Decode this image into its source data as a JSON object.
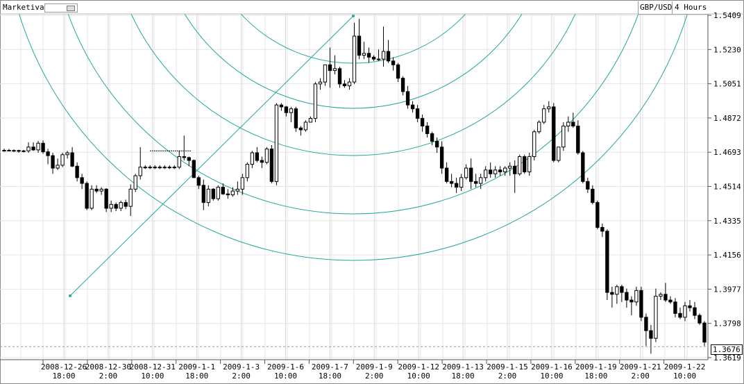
{
  "app": {
    "name": "Marketiva"
  },
  "instrument": {
    "symbol": "GBP/USD",
    "timeframe": "4 Hours"
  },
  "current_price": "1.3676",
  "colors": {
    "arc": "#22a89a",
    "up_fill": "#ffffff",
    "down_fill": "#000000",
    "grid": "#e6e6e6"
  },
  "chart_data": {
    "type": "candlestick",
    "y_ticks": [
      "1.5409",
      "1.5230",
      "1.5051",
      "1.4872",
      "1.4693",
      "1.4514",
      "1.4335",
      "1.4156",
      "1.3977",
      "1.3798",
      "1.3619"
    ],
    "ylim": [
      1.3585,
      1.543
    ],
    "x_ticks": [
      {
        "date": "2008-12-26",
        "time": "18:00"
      },
      {
        "date": "2008-12-30",
        "time": "2:00"
      },
      {
        "date": "2008-12-31",
        "time": "10:00"
      },
      {
        "date": "2009-1-1",
        "time": "18:00"
      },
      {
        "date": "2009-1-3",
        "time": "2:00"
      },
      {
        "date": "2009-1-6",
        "time": "10:00"
      },
      {
        "date": "2009-1-7",
        "time": "18:00"
      },
      {
        "date": "2009-1-9",
        "time": "2:00"
      },
      {
        "date": "2009-1-12",
        "time": "10:00"
      },
      {
        "date": "2009-1-13",
        "time": "18:00"
      },
      {
        "date": "2009-1-15",
        "time": "2:00"
      },
      {
        "date": "2009-1-16",
        "time": "10:00"
      },
      {
        "date": "2009-1-19",
        "time": "18:00"
      },
      {
        "date": "2009-1-21",
        "time": "2:00"
      },
      {
        "date": "2009-1-22",
        "time": "10:00"
      }
    ],
    "candles": [
      [
        1.47,
        1.4712,
        1.4695,
        1.4703
      ],
      [
        1.4703,
        1.471,
        1.4698,
        1.47
      ],
      [
        1.47,
        1.4708,
        1.4695,
        1.4702
      ],
      [
        1.4702,
        1.4706,
        1.469,
        1.4698
      ],
      [
        1.4698,
        1.4705,
        1.4692,
        1.47
      ],
      [
        1.47,
        1.4745,
        1.469,
        1.472
      ],
      [
        1.472,
        1.4745,
        1.47,
        1.4705
      ],
      [
        1.4705,
        1.4752,
        1.469,
        1.474
      ],
      [
        1.474,
        1.4755,
        1.4685,
        1.4695
      ],
      [
        1.4695,
        1.471,
        1.463,
        1.4675
      ],
      [
        1.4675,
        1.469,
        1.458,
        1.461
      ],
      [
        1.461,
        1.466,
        1.46,
        1.4625
      ],
      [
        1.4625,
        1.469,
        1.4615,
        1.468
      ],
      [
        1.468,
        1.47,
        1.466,
        1.469
      ],
      [
        1.469,
        1.472,
        1.4615,
        1.462
      ],
      [
        1.462,
        1.464,
        1.454,
        1.456
      ],
      [
        1.456,
        1.458,
        1.45,
        1.453
      ],
      [
        1.453,
        1.454,
        1.439,
        1.44
      ],
      [
        1.44,
        1.452,
        1.439,
        1.45
      ],
      [
        1.45,
        1.452,
        1.448,
        1.449
      ],
      [
        1.449,
        1.451,
        1.447,
        1.45
      ],
      [
        1.45,
        1.4505,
        1.438,
        1.44
      ],
      [
        1.44,
        1.444,
        1.438,
        1.442
      ],
      [
        1.442,
        1.443,
        1.4385,
        1.44
      ],
      [
        1.44,
        1.444,
        1.4385,
        1.443
      ],
      [
        1.443,
        1.4445,
        1.4395,
        1.441
      ],
      [
        1.441,
        1.4525,
        1.436,
        1.45
      ],
      [
        1.45,
        1.458,
        1.4485,
        1.457
      ],
      [
        1.457,
        1.472,
        1.455,
        1.4615
      ],
      [
        1.4615,
        1.4625,
        1.4605,
        1.4615
      ],
      [
        1.4615,
        1.4625,
        1.4605,
        1.4615
      ],
      [
        1.4615,
        1.4625,
        1.4605,
        1.4615
      ],
      [
        1.4615,
        1.4625,
        1.4605,
        1.4615
      ],
      [
        1.4615,
        1.4625,
        1.4605,
        1.4615
      ],
      [
        1.4615,
        1.4625,
        1.4605,
        1.4615
      ],
      [
        1.4615,
        1.4625,
        1.4605,
        1.4615
      ],
      [
        1.4615,
        1.47,
        1.4605,
        1.467
      ],
      [
        1.467,
        1.478,
        1.465,
        1.4665
      ],
      [
        1.4665,
        1.467,
        1.462,
        1.465
      ],
      [
        1.465,
        1.4655,
        1.456,
        1.456
      ],
      [
        1.456,
        1.457,
        1.45,
        1.452
      ],
      [
        1.452,
        1.455,
        1.439,
        1.443
      ],
      [
        1.443,
        1.452,
        1.441,
        1.45
      ],
      [
        1.45,
        1.4505,
        1.444,
        1.445
      ],
      [
        1.445,
        1.452,
        1.444,
        1.451
      ],
      [
        1.451,
        1.453,
        1.447,
        1.4475
      ],
      [
        1.4475,
        1.45,
        1.445,
        1.447
      ],
      [
        1.447,
        1.451,
        1.446,
        1.449
      ],
      [
        1.449,
        1.454,
        1.447,
        1.45
      ],
      [
        1.45,
        1.458,
        1.447,
        1.456
      ],
      [
        1.456,
        1.464,
        1.454,
        1.463
      ],
      [
        1.463,
        1.47,
        1.461,
        1.469
      ],
      [
        1.469,
        1.472,
        1.464,
        1.465
      ],
      [
        1.465,
        1.467,
        1.461,
        1.464
      ],
      [
        1.464,
        1.472,
        1.463,
        1.471
      ],
      [
        1.471,
        1.473,
        1.453,
        1.454
      ],
      [
        1.454,
        1.495,
        1.452,
        1.494
      ],
      [
        1.494,
        1.495,
        1.491,
        1.493
      ],
      [
        1.493,
        1.4935,
        1.488,
        1.49
      ],
      [
        1.49,
        1.493,
        1.485,
        1.492
      ],
      [
        1.492,
        1.493,
        1.48,
        1.482
      ],
      [
        1.482,
        1.483,
        1.478,
        1.481
      ],
      [
        1.481,
        1.486,
        1.48,
        1.485
      ],
      [
        1.485,
        1.488,
        1.485,
        1.487
      ],
      [
        1.487,
        1.506,
        1.485,
        1.505
      ],
      [
        1.505,
        1.508,
        1.502,
        1.506
      ],
      [
        1.506,
        1.515,
        1.504,
        1.515
      ],
      [
        1.515,
        1.524,
        1.503,
        1.512
      ],
      [
        1.512,
        1.52,
        1.51,
        1.513
      ],
      [
        1.513,
        1.514,
        1.503,
        1.505
      ],
      [
        1.505,
        1.507,
        1.503,
        1.504
      ],
      [
        1.504,
        1.508,
        1.502,
        1.506
      ],
      [
        1.506,
        1.537,
        1.505,
        1.53
      ],
      [
        1.53,
        1.539,
        1.518,
        1.52
      ],
      [
        1.52,
        1.527,
        1.518,
        1.521
      ],
      [
        1.521,
        1.524,
        1.516,
        1.519
      ],
      [
        1.519,
        1.52,
        1.517,
        1.518
      ],
      [
        1.518,
        1.523,
        1.517,
        1.518
      ],
      [
        1.518,
        1.535,
        1.514,
        1.522
      ],
      [
        1.522,
        1.528,
        1.516,
        1.517
      ],
      [
        1.517,
        1.519,
        1.512,
        1.515
      ],
      [
        1.515,
        1.516,
        1.506,
        1.508
      ],
      [
        1.508,
        1.509,
        1.499,
        1.501
      ],
      [
        1.501,
        1.504,
        1.492,
        1.494
      ],
      [
        1.494,
        1.496,
        1.49,
        1.492
      ],
      [
        1.492,
        1.494,
        1.485,
        1.487
      ],
      [
        1.487,
        1.489,
        1.48,
        1.483
      ],
      [
        1.483,
        1.485,
        1.477,
        1.479
      ],
      [
        1.479,
        1.48,
        1.473,
        1.475
      ],
      [
        1.475,
        1.477,
        1.469,
        1.472
      ],
      [
        1.472,
        1.475,
        1.458,
        1.461
      ],
      [
        1.461,
        1.464,
        1.453,
        1.454
      ],
      [
        1.454,
        1.458,
        1.451,
        1.453
      ],
      [
        1.453,
        1.456,
        1.448,
        1.451
      ],
      [
        1.451,
        1.458,
        1.449,
        1.456
      ],
      [
        1.456,
        1.463,
        1.455,
        1.461
      ],
      [
        1.461,
        1.466,
        1.45,
        1.454
      ],
      [
        1.454,
        1.458,
        1.451,
        1.453
      ],
      [
        1.453,
        1.458,
        1.45,
        1.456
      ],
      [
        1.456,
        1.462,
        1.454,
        1.46
      ],
      [
        1.46,
        1.464,
        1.456,
        1.458
      ],
      [
        1.458,
        1.462,
        1.456,
        1.46
      ],
      [
        1.46,
        1.462,
        1.457,
        1.459
      ],
      [
        1.459,
        1.462,
        1.457,
        1.461
      ],
      [
        1.461,
        1.464,
        1.457,
        1.462
      ],
      [
        1.462,
        1.465,
        1.448,
        1.458
      ],
      [
        1.458,
        1.468,
        1.457,
        1.467
      ],
      [
        1.467,
        1.468,
        1.458,
        1.459
      ],
      [
        1.459,
        1.469,
        1.457,
        1.467
      ],
      [
        1.467,
        1.481,
        1.465,
        1.48
      ],
      [
        1.48,
        1.486,
        1.479,
        1.485
      ],
      [
        1.485,
        1.494,
        1.484,
        1.492
      ],
      [
        1.492,
        1.496,
        1.49,
        1.493
      ],
      [
        1.493,
        1.495,
        1.464,
        1.465
      ],
      [
        1.465,
        1.472,
        1.464,
        1.472
      ],
      [
        1.472,
        1.485,
        1.47,
        1.483
      ],
      [
        1.483,
        1.488,
        1.48,
        1.485
      ],
      [
        1.485,
        1.49,
        1.482,
        1.483
      ],
      [
        1.483,
        1.486,
        1.468,
        1.469
      ],
      [
        1.469,
        1.47,
        1.453,
        1.454
      ],
      [
        1.454,
        1.456,
        1.448,
        1.45
      ],
      [
        1.45,
        1.452,
        1.442,
        1.443
      ],
      [
        1.443,
        1.444,
        1.429,
        1.43
      ],
      [
        1.43,
        1.432,
        1.425,
        1.428
      ],
      [
        1.428,
        1.429,
        1.392,
        1.396
      ],
      [
        1.396,
        1.399,
        1.388,
        1.395
      ],
      [
        1.395,
        1.4,
        1.39,
        1.399
      ],
      [
        1.399,
        1.4,
        1.391,
        1.396
      ],
      [
        1.396,
        1.398,
        1.388,
        1.392
      ],
      [
        1.392,
        1.394,
        1.384,
        1.391
      ],
      [
        1.391,
        1.399,
        1.389,
        1.397
      ],
      [
        1.397,
        1.399,
        1.381,
        1.383
      ],
      [
        1.383,
        1.385,
        1.368,
        1.376
      ],
      [
        1.376,
        1.379,
        1.364,
        1.372
      ],
      [
        1.372,
        1.398,
        1.37,
        1.394
      ],
      [
        1.394,
        1.396,
        1.392,
        1.395
      ],
      [
        1.395,
        1.401,
        1.391,
        1.392
      ],
      [
        1.392,
        1.394,
        1.39,
        1.391
      ],
      [
        1.391,
        1.393,
        1.383,
        1.385
      ],
      [
        1.385,
        1.388,
        1.382,
        1.383
      ],
      [
        1.383,
        1.391,
        1.381,
        1.389
      ],
      [
        1.389,
        1.392,
        1.386,
        1.388
      ],
      [
        1.388,
        1.391,
        1.382,
        1.384
      ],
      [
        1.384,
        1.385,
        1.379,
        1.38
      ],
      [
        1.38,
        1.381,
        1.368,
        1.37
      ]
    ],
    "grid": true
  }
}
